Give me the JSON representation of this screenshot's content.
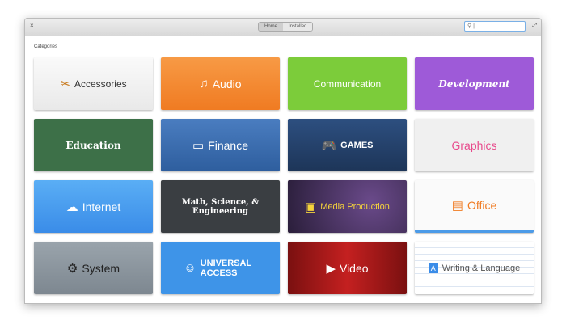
{
  "header": {
    "close": "×",
    "maximize": "⤢",
    "tabs": [
      "Home",
      "Installed"
    ],
    "search_placeholder": ""
  },
  "section_label": "Categories",
  "categories": [
    {
      "label": "Accessories",
      "icon": "✂"
    },
    {
      "label": "Audio",
      "icon": "♫"
    },
    {
      "label": "Communication",
      "icon": ""
    },
    {
      "label": "Development",
      "icon": ""
    },
    {
      "label": "Education",
      "icon": ""
    },
    {
      "label": "Finance",
      "icon": "▭"
    },
    {
      "label": "GAMES",
      "icon": "🎮"
    },
    {
      "label": "Graphics",
      "icon": ""
    },
    {
      "label": "Internet",
      "icon": "☁"
    },
    {
      "label": "Math, Science, & Engineering",
      "icon": ""
    },
    {
      "label": "Media Production",
      "icon": "▣"
    },
    {
      "label": "Office",
      "icon": "▤"
    },
    {
      "label": "System",
      "icon": "⚙"
    },
    {
      "label": "UNIVERSAL ACCESS",
      "icon": "☺"
    },
    {
      "label": "Video",
      "icon": "▶"
    },
    {
      "label": "Writing & Language",
      "icon": "A"
    }
  ]
}
